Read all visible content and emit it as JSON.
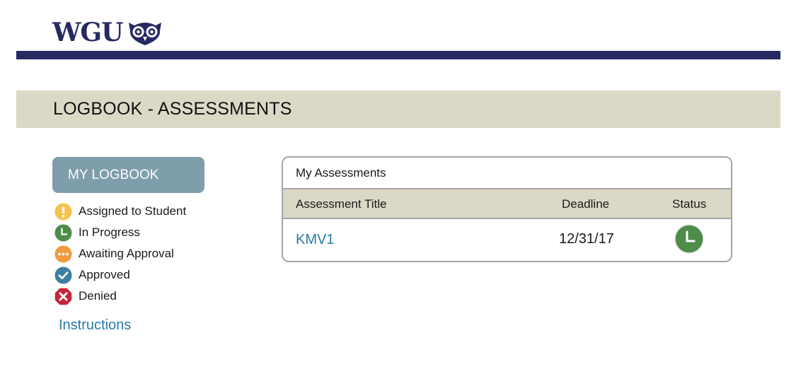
{
  "brand": {
    "name": "WGU",
    "primary_color": "#262a63"
  },
  "page": {
    "title": "LOGBOOK - ASSESSMENTS",
    "band_color": "#dcd8c6"
  },
  "sidebar": {
    "my_logbook_label": "MY LOGBOOK",
    "legend": [
      {
        "icon": "exclamation-icon",
        "label": "Assigned to Student",
        "color": "#f7c24a"
      },
      {
        "icon": "clock-icon",
        "label": "In Progress",
        "color": "#4e8c4a"
      },
      {
        "icon": "ellipsis-icon",
        "label": "Awaiting Approval",
        "color": "#f19a3e"
      },
      {
        "icon": "check-icon",
        "label": "Approved",
        "color": "#3d7fa0"
      },
      {
        "icon": "x-icon",
        "label": "Denied",
        "color": "#c8253a"
      }
    ],
    "instructions_label": "Instructions",
    "link_color": "#2878a8"
  },
  "assessments": {
    "panel_title": "My Assessments",
    "columns": {
      "title": "Assessment Title",
      "deadline": "Deadline",
      "status": "Status"
    },
    "rows": [
      {
        "title": "KMV1",
        "deadline": "12/31/17",
        "status_icon": "clock-icon",
        "status": "In Progress"
      }
    ]
  }
}
